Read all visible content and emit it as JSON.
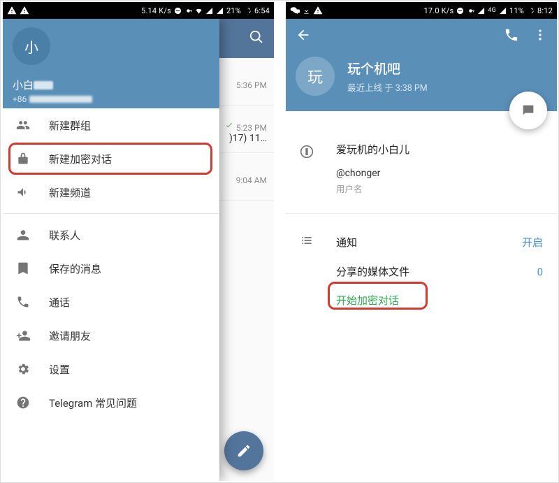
{
  "left": {
    "status": {
      "speed": "5.14 K/s",
      "battery": "21%",
      "time": "6:54"
    },
    "drawer": {
      "avatar_letter": "小",
      "user_name_visible": "小白",
      "phone_prefix": "+86",
      "items": [
        {
          "icon": "group-icon",
          "label": "新建群组"
        },
        {
          "icon": "lock-icon",
          "label": "新建加密对话"
        },
        {
          "icon": "megaphone-icon",
          "label": "新建频道"
        }
      ],
      "items2": [
        {
          "icon": "person-icon",
          "label": "联系人"
        },
        {
          "icon": "bookmark-icon",
          "label": "保存的消息"
        },
        {
          "icon": "phone-icon",
          "label": "通话"
        },
        {
          "icon": "add-person-icon",
          "label": "邀请朋友"
        },
        {
          "icon": "gear-icon",
          "label": "设置"
        },
        {
          "icon": "help-icon",
          "label": "Telegram 常见问题"
        }
      ]
    },
    "bg_chats": [
      {
        "time": "5:36 PM",
        "sub": ""
      },
      {
        "time": "5:23 PM",
        "sub": ")17) 11…",
        "checked": true
      },
      {
        "time": "9:04 AM",
        "sub": ""
      }
    ]
  },
  "right": {
    "status": {
      "speed": "17.0 K/s",
      "net": "4G",
      "battery": "11%",
      "time": "8:12"
    },
    "profile": {
      "avatar_letter": "玩",
      "title": "玩个机吧",
      "last_seen": "最近上线 于 3:38 PM"
    },
    "info": {
      "display_name": "爱玩机的小白儿",
      "username": "@chonger",
      "username_caption": "用户名"
    },
    "rows": {
      "notifications_label": "通知",
      "notifications_value": "开启",
      "shared_media_label": "分享的媒体文件",
      "shared_media_value": "0",
      "start_secret_label": "开始加密对话"
    }
  }
}
